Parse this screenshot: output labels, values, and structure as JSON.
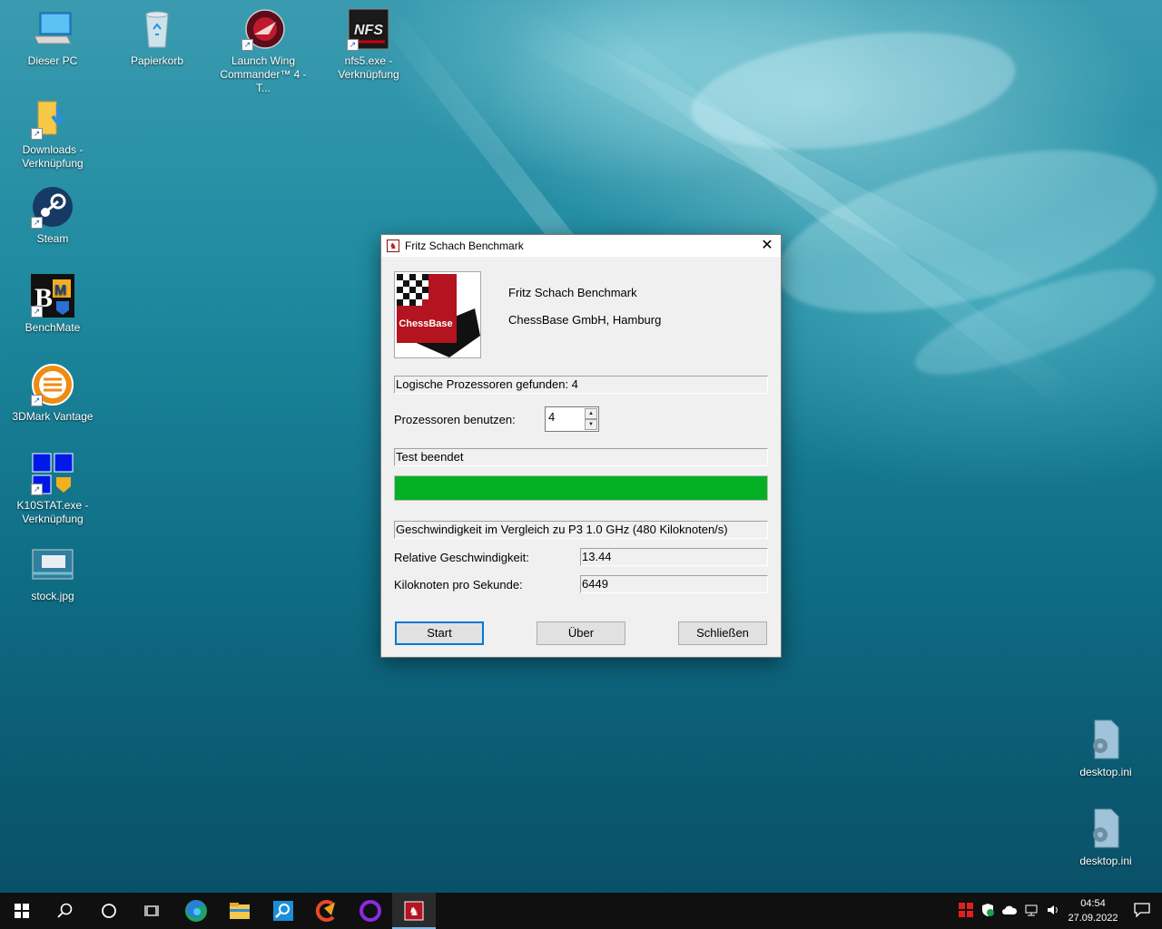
{
  "desktop": {
    "icons": [
      {
        "label": "Dieser PC",
        "icon": "computer-icon"
      },
      {
        "label": "Papierkorb",
        "icon": "recycle-bin-icon"
      },
      {
        "label": "Launch Wing Commander™ 4 - T...",
        "icon": "wing-commander-icon"
      },
      {
        "label": "nfs5.exe - Verknüpfung",
        "icon": "nfs-icon"
      },
      {
        "label": "Downloads - Verknüpfung",
        "icon": "downloads-folder-icon"
      },
      {
        "label": "Steam",
        "icon": "steam-icon"
      },
      {
        "label": "BenchMate",
        "icon": "benchmate-icon"
      },
      {
        "label": "3DMark Vantage",
        "icon": "3dmark-icon"
      },
      {
        "label": "K10STAT.exe - Verknüpfung",
        "icon": "k10stat-icon"
      },
      {
        "label": "stock.jpg",
        "icon": "image-file-icon"
      },
      {
        "label": "desktop.ini",
        "icon": "settings-file-icon"
      },
      {
        "label": "desktop.ini",
        "icon": "settings-file-icon"
      }
    ]
  },
  "dialog": {
    "title": "Fritz Schach Benchmark",
    "logo_text": "ChessBase",
    "app_name": "Fritz Schach Benchmark",
    "company": "ChessBase GmbH, Hamburg",
    "processors_found": "Logische Prozessoren gefunden: 4",
    "use_processors_label": "Prozessoren benutzen:",
    "use_processors_value": "4",
    "status": "Test beendet",
    "progress": 1.0,
    "comparison": "Geschwindigkeit im Vergleich zu P3 1.0 GHz (480 Kiloknoten/s)",
    "relative_speed_label": "Relative Geschwindigkeit:",
    "relative_speed_value": "13.44",
    "kn_per_sec_label": "Kiloknoten pro Sekunde:",
    "kn_per_sec_value": "6449",
    "buttons": {
      "start": "Start",
      "about": "Über",
      "close": "Schließen"
    },
    "accent_color": "#06b025"
  },
  "taskbar": {
    "apps": [
      "windows-start-icon",
      "search-icon",
      "cortana-icon",
      "task-view-icon",
      "edge-icon",
      "file-explorer-icon",
      "magnifier-app-icon",
      "ccleaner-icon",
      "purple-ring-app-icon",
      "fritz-benchmark-icon"
    ],
    "clock_time": "04:54",
    "clock_date": "27.09.2022"
  }
}
